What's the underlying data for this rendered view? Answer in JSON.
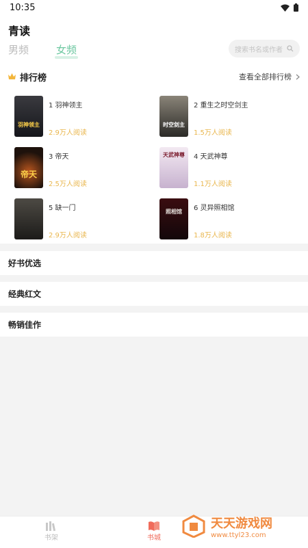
{
  "status": {
    "time": "10:35"
  },
  "header": {
    "app_title": "青读",
    "tabs": [
      {
        "label": "男频"
      },
      {
        "label": "女频"
      }
    ],
    "search_placeholder": "搜索书名或作者"
  },
  "ranking": {
    "title": "排行榜",
    "view_all": "查看全部排行榜",
    "books": [
      {
        "rank_name": "1 羽神领主",
        "reads": "2.9万人阅读",
        "cover_text": "羽神领主"
      },
      {
        "rank_name": "2 重生之时空剑主",
        "reads": "1.5万人阅读",
        "cover_text": "时空剑主"
      },
      {
        "rank_name": "3 帝天",
        "reads": "2.5万人阅读",
        "cover_text": "帝天"
      },
      {
        "rank_name": "4 天武神尊",
        "reads": "1.1万人阅读",
        "cover_text": "天武神尊"
      },
      {
        "rank_name": "5 缺一门",
        "reads": "2.9万人阅读",
        "cover_text": ""
      },
      {
        "rank_name": "6 灵异照相馆",
        "reads": "1.8万人阅读",
        "cover_text": "照相馆"
      }
    ]
  },
  "sections": [
    {
      "title": "好书优选"
    },
    {
      "title": "经典红文"
    },
    {
      "title": "畅销佳作"
    }
  ],
  "bottom_nav": [
    {
      "label": "书架"
    },
    {
      "label": "书城"
    }
  ],
  "watermark": {
    "main": "天天游戏网",
    "url": "www.ttyl23.com"
  },
  "colors": {
    "accent": "#6cc7a0",
    "reads": "#e9b64d",
    "nav_active": "#f06b5b",
    "watermark": "#f08a40"
  }
}
